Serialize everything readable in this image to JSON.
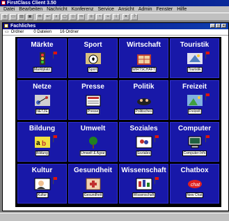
{
  "app": {
    "title": "FirstClass Client 3.50"
  },
  "menu": [
    "Datei",
    "Bearbeiten",
    "Nachricht",
    "Konferenz",
    "Service",
    "Ansicht",
    "Admin",
    "Fenster",
    "Hilfe"
  ],
  "window": {
    "title": "Fachliches",
    "status": {
      "folder_label": "Ordner",
      "files": "0 Dateien",
      "folders": "16 Ordner"
    }
  },
  "tiles": [
    {
      "name": "Märkte",
      "label": "Marktplatz",
      "icon": "traffic-light-icon"
    },
    {
      "name": "Sport",
      "label": "Sport",
      "icon": "soccer-ball-icon"
    },
    {
      "name": "Wirtschaft",
      "label": "WIRTSCHAFT",
      "icon": "building-icon"
    },
    {
      "name": "Touristik",
      "label": "Touristik",
      "icon": "travel-icon"
    },
    {
      "name": "Netze",
      "label": "NETZE",
      "icon": "network-icon"
    },
    {
      "name": "Presse",
      "label": "Presse",
      "icon": "newspaper-icon"
    },
    {
      "name": "Politik",
      "label": "Politisches",
      "icon": "politics-icon"
    },
    {
      "name": "Freizeit",
      "label": "Freizeit",
      "icon": "leisure-icon"
    },
    {
      "name": "Bildung",
      "label": "Bildung",
      "icon": "education-icon"
    },
    {
      "name": "Umwelt",
      "label": "Umwelt & Agrar",
      "icon": "tree-icon"
    },
    {
      "name": "Soziales",
      "label": "Soziales",
      "icon": "social-icon"
    },
    {
      "name": "Computer",
      "label": "Computer-Info",
      "icon": "computer-icon"
    },
    {
      "name": "Kultur",
      "label": "Kultur",
      "icon": "culture-icon"
    },
    {
      "name": "Gesundheit",
      "label": "Gesundheit",
      "icon": "health-icon"
    },
    {
      "name": "Wissenschaft",
      "label": "Wissenschaft",
      "icon": "science-icon"
    },
    {
      "name": "Chatbox",
      "label": "New Chat",
      "icon": "chat-icon"
    }
  ],
  "colors": {
    "tile_bg": "#1818a8",
    "title_bar": "#000080",
    "flag": "#e01010"
  }
}
